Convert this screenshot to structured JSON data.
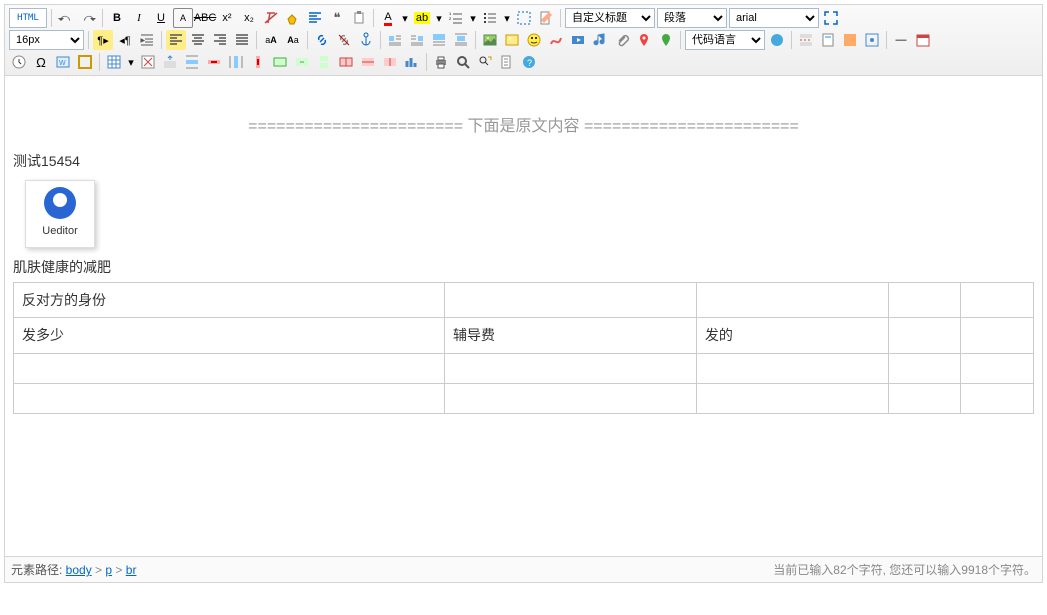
{
  "selects": {
    "title": "自定义标题",
    "para": "段落",
    "font": "arial",
    "size": "16px",
    "code": "代码语言"
  },
  "content": {
    "divider": "======================= 下面是原文内容 =======================",
    "line1": "测试15454",
    "img_caption": "Ueditor",
    "line2": "肌肤健康的减肥",
    "table": [
      [
        "反对方的身份",
        "",
        "",
        "",
        ""
      ],
      [
        "发多少",
        "辅导费",
        "发的",
        "",
        ""
      ],
      [
        "",
        "",
        "",
        "",
        ""
      ],
      [
        "",
        "",
        "",
        "",
        ""
      ]
    ]
  },
  "status": {
    "path_label": "元素路径: ",
    "p1": "body",
    "p2": "p",
    "p3": "br",
    "sep": " > ",
    "count": "当前已输入82个字符, 您还可以输入9918个字符。"
  }
}
